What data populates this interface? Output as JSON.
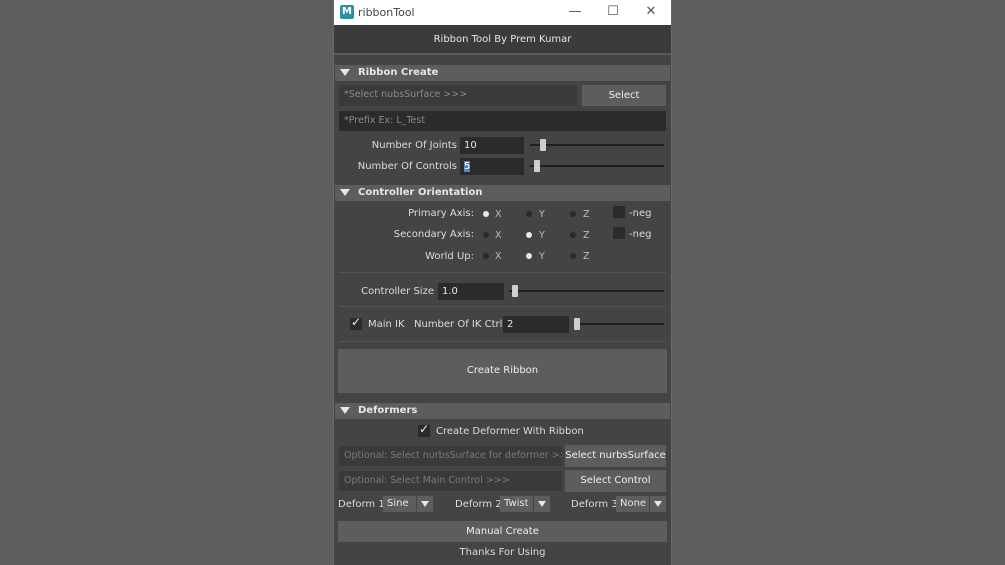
{
  "window": {
    "title": "ribbonTool",
    "icon": "maya-icon",
    "minimize": "—",
    "maximize": "☐",
    "close": "✕"
  },
  "header": {
    "title": "Ribbon Tool By Prem Kumar"
  },
  "ribbon_create": {
    "label": "Ribbon Create",
    "surface_placeholder": "*Select nubsSurface >>>",
    "select_button": "Select",
    "prefix_placeholder": "*Prefix Ex: L_Test",
    "joints_label": "Number Of Joints",
    "joints_value": "10",
    "controls_label": "Number Of Controls",
    "controls_value": "5"
  },
  "orientation": {
    "label": "Controller Orientation",
    "primary_label": "Primary Axis:",
    "secondary_label": "Secondary Axis:",
    "world_label": "World Up:",
    "x": "X",
    "y": "Y",
    "z": "Z",
    "neg": "-neg",
    "primary_selected": "X",
    "secondary_selected": "Y",
    "world_selected": "Y",
    "controller_size_label": "Controller Size",
    "controller_size_value": "1.0",
    "main_ik_label": "Main IK",
    "main_ik_checked": true,
    "ik_ctrl_label": "Number Of IK Ctrl",
    "ik_ctrl_value": "2",
    "create_button": "Create Ribbon"
  },
  "deformers": {
    "label": "Deformers",
    "create_with_ribbon_label": "Create Deformer With Ribbon",
    "create_with_ribbon_checked": true,
    "surface_placeholder": "Optional: Select nurbsSurface for deformer >>>",
    "select_surface_button": "Select nurbsSurface",
    "control_placeholder": "Optional: Select Main Control >>>",
    "select_control_button": "Select Control",
    "deform1_label": "Deform 1",
    "deform1_value": "Sine",
    "deform2_label": "Deform 2",
    "deform2_value": "Twist",
    "deform3_label": "Deform 3",
    "deform3_value": "None",
    "manual_button": "Manual Create",
    "footer": "Thanks For Using"
  }
}
